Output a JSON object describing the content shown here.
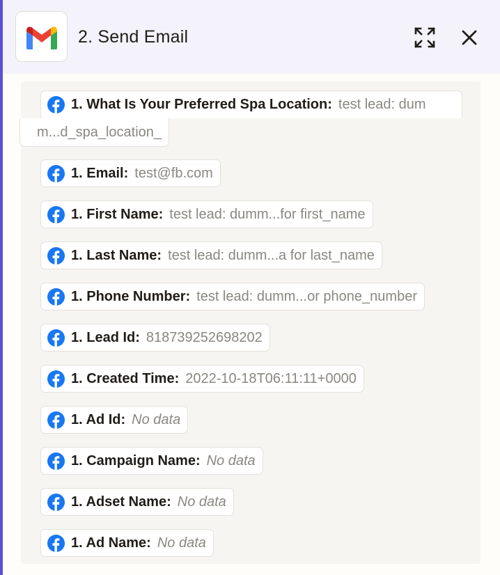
{
  "header": {
    "title": "2. Send Email",
    "app_icon": "gmail-icon",
    "expand_icon": "expand-icon",
    "close_icon": "close-icon"
  },
  "fields": [
    {
      "key": "1. What Is Your Preferred Spa Location:",
      "value": "test lead: dum",
      "value_cont": "m...d_spa_location_",
      "nodata": false
    },
    {
      "key": "1. Email:",
      "value": "test@fb.com",
      "nodata": false
    },
    {
      "key": "1. First Name:",
      "value": "test lead: dumm...for first_name",
      "nodata": false
    },
    {
      "key": "1. Last Name:",
      "value": "test lead: dumm...a for last_name",
      "nodata": false
    },
    {
      "key": "1. Phone Number:",
      "value": "test lead: dumm...or phone_number",
      "nodata": false
    },
    {
      "key": "1. Lead Id:",
      "value": "818739252698202",
      "nodata": false
    },
    {
      "key": "1. Created Time:",
      "value": "2022-10-18T06:11:11+0000",
      "nodata": false
    },
    {
      "key": "1. Ad Id:",
      "value": "No data",
      "nodata": true
    },
    {
      "key": "1. Campaign Name:",
      "value": "No data",
      "nodata": true
    },
    {
      "key": "1. Adset Name:",
      "value": "No data",
      "nodata": true
    },
    {
      "key": "1. Ad Name:",
      "value": "No data",
      "nodata": true
    }
  ],
  "colors": {
    "accent": "#5b50d6",
    "facebook": "#1877f2",
    "gmail_red": "#ea4335",
    "gmail_blue": "#4285f4",
    "gmail_green": "#34a853",
    "gmail_yellow": "#fbbc04"
  }
}
